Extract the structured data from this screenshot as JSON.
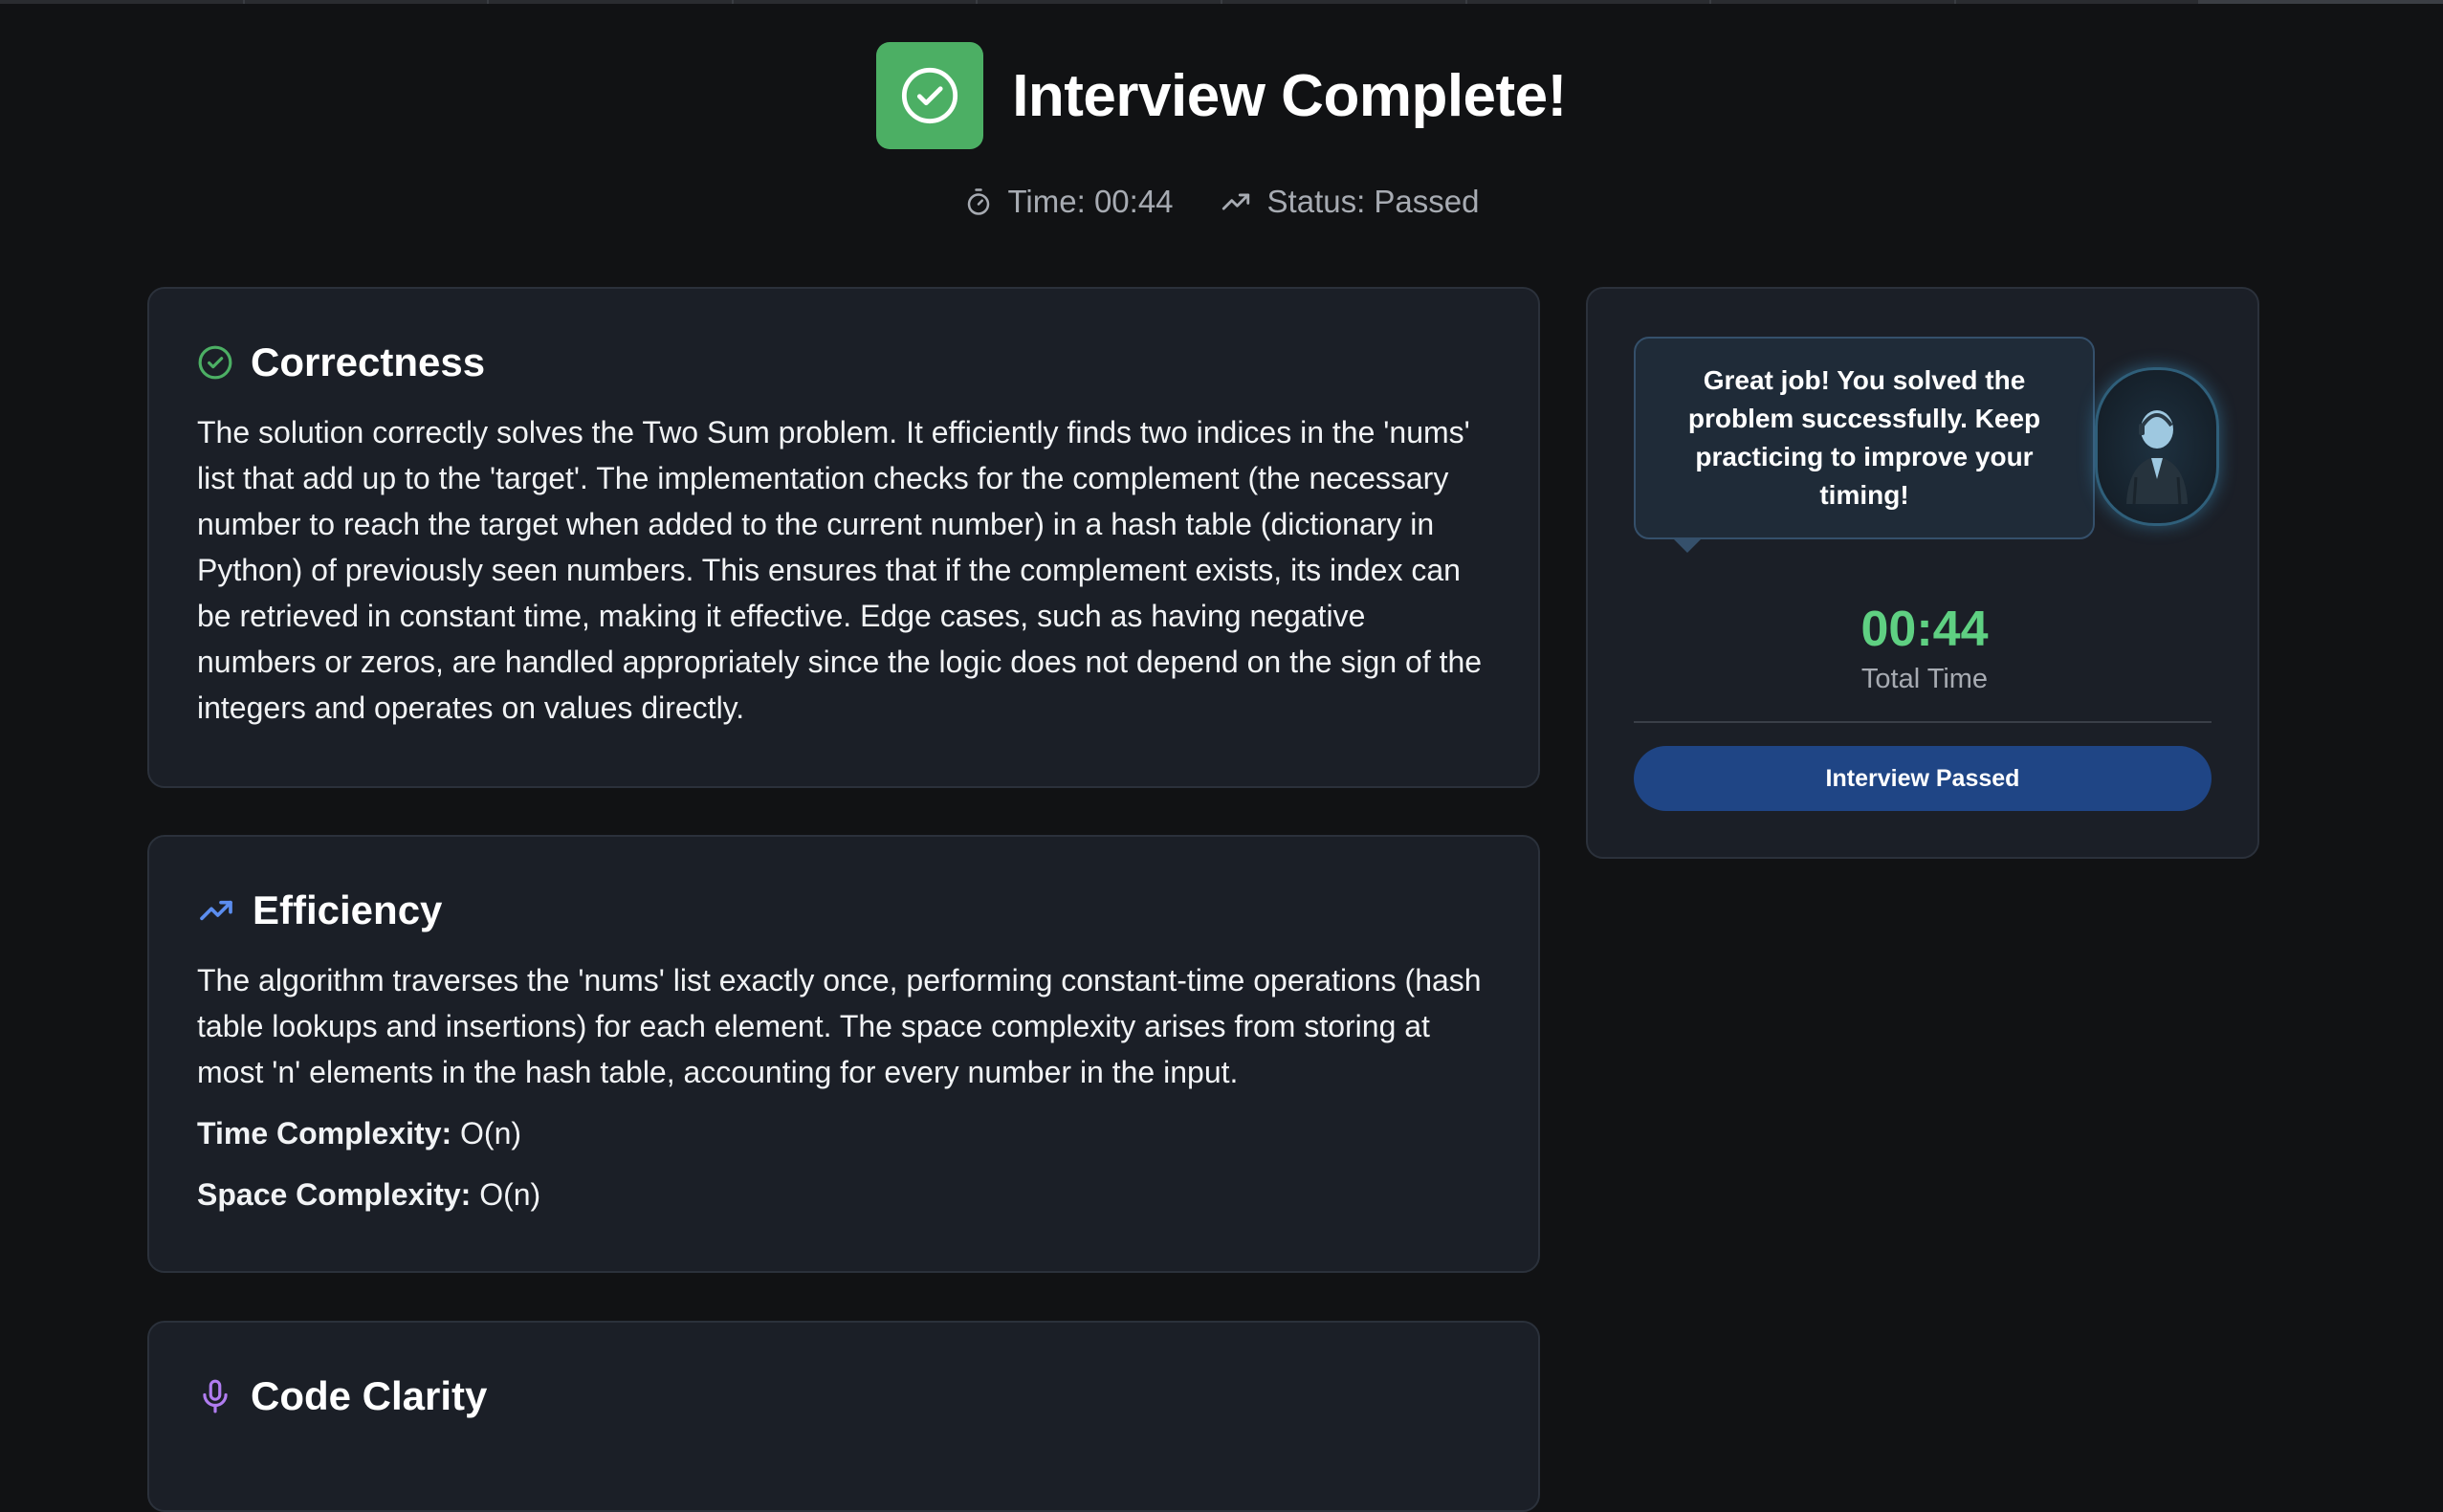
{
  "header": {
    "title": "Interview Complete!",
    "time_label": "Time: 00:44",
    "status_label": "Status: Passed"
  },
  "sections": {
    "correctness": {
      "title": "Correctness",
      "icon": "check-circle-icon",
      "body": "The solution correctly solves the Two Sum problem. It efficiently finds two indices in the 'nums' list that add up to the 'target'. The implementation checks for the complement (the necessary number to reach the target when added to the current number) in a hash table (dictionary in Python) of previously seen numbers. This ensures that if the complement exists, its index can be retrieved in constant time, making it effective. Edge cases, such as having negative numbers or zeros, are handled appropriately since the logic does not depend on the sign of the integers and operates on values directly."
    },
    "efficiency": {
      "title": "Efficiency",
      "icon": "trending-up-icon",
      "body": "The algorithm traverses the 'nums' list exactly once, performing constant-time operations (hash table lookups and insertions) for each element. The space complexity arises from storing at most 'n' elements in the hash table, accounting for every number in the input.",
      "time_complexity_label": "Time Complexity:",
      "time_complexity_value": "O(n)",
      "space_complexity_label": "Space Complexity:",
      "space_complexity_value": "O(n)"
    },
    "clarity": {
      "title": "Code Clarity",
      "icon": "microphone-icon"
    }
  },
  "side_panel": {
    "message": "Great job! You solved the problem successfully. Keep practicing to improve your timing!",
    "timer_value": "00:44",
    "timer_label": "Total Time",
    "button_label": "Interview Passed"
  },
  "colors": {
    "background": "#111214",
    "card": "#1b1f27",
    "success_green": "#4caf64",
    "timer_green": "#5fd082",
    "efficiency_blue": "#5b8def",
    "clarity_purple": "#b07cf0",
    "button_blue": "#1f4585"
  }
}
